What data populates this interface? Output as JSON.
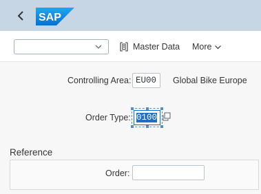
{
  "shell": {
    "back_icon": "chevron-left-icon",
    "logo_text": "SAP",
    "colors": {
      "shell_bg": "#c7d6e5",
      "logo_bg": "#0a8ce0"
    }
  },
  "toolbar": {
    "variant_value": "",
    "master_data_label": "Master Data",
    "master_data_icon": "document-icon",
    "more_label": "More",
    "more_icon": "chevron-down-icon"
  },
  "form": {
    "controlling_area_label": "Controlling Area:",
    "controlling_area_value": "EU00",
    "controlling_area_desc": "Global Bike Europe",
    "order_type_label": "Order Type:",
    "order_type_value": "0100",
    "value_help_icon": "copy-icon"
  },
  "reference": {
    "title": "Reference",
    "order_label": "Order:",
    "order_value": ""
  },
  "colors": {
    "selection": "#1f6fc9",
    "focus_border": "#0a6ed1"
  }
}
